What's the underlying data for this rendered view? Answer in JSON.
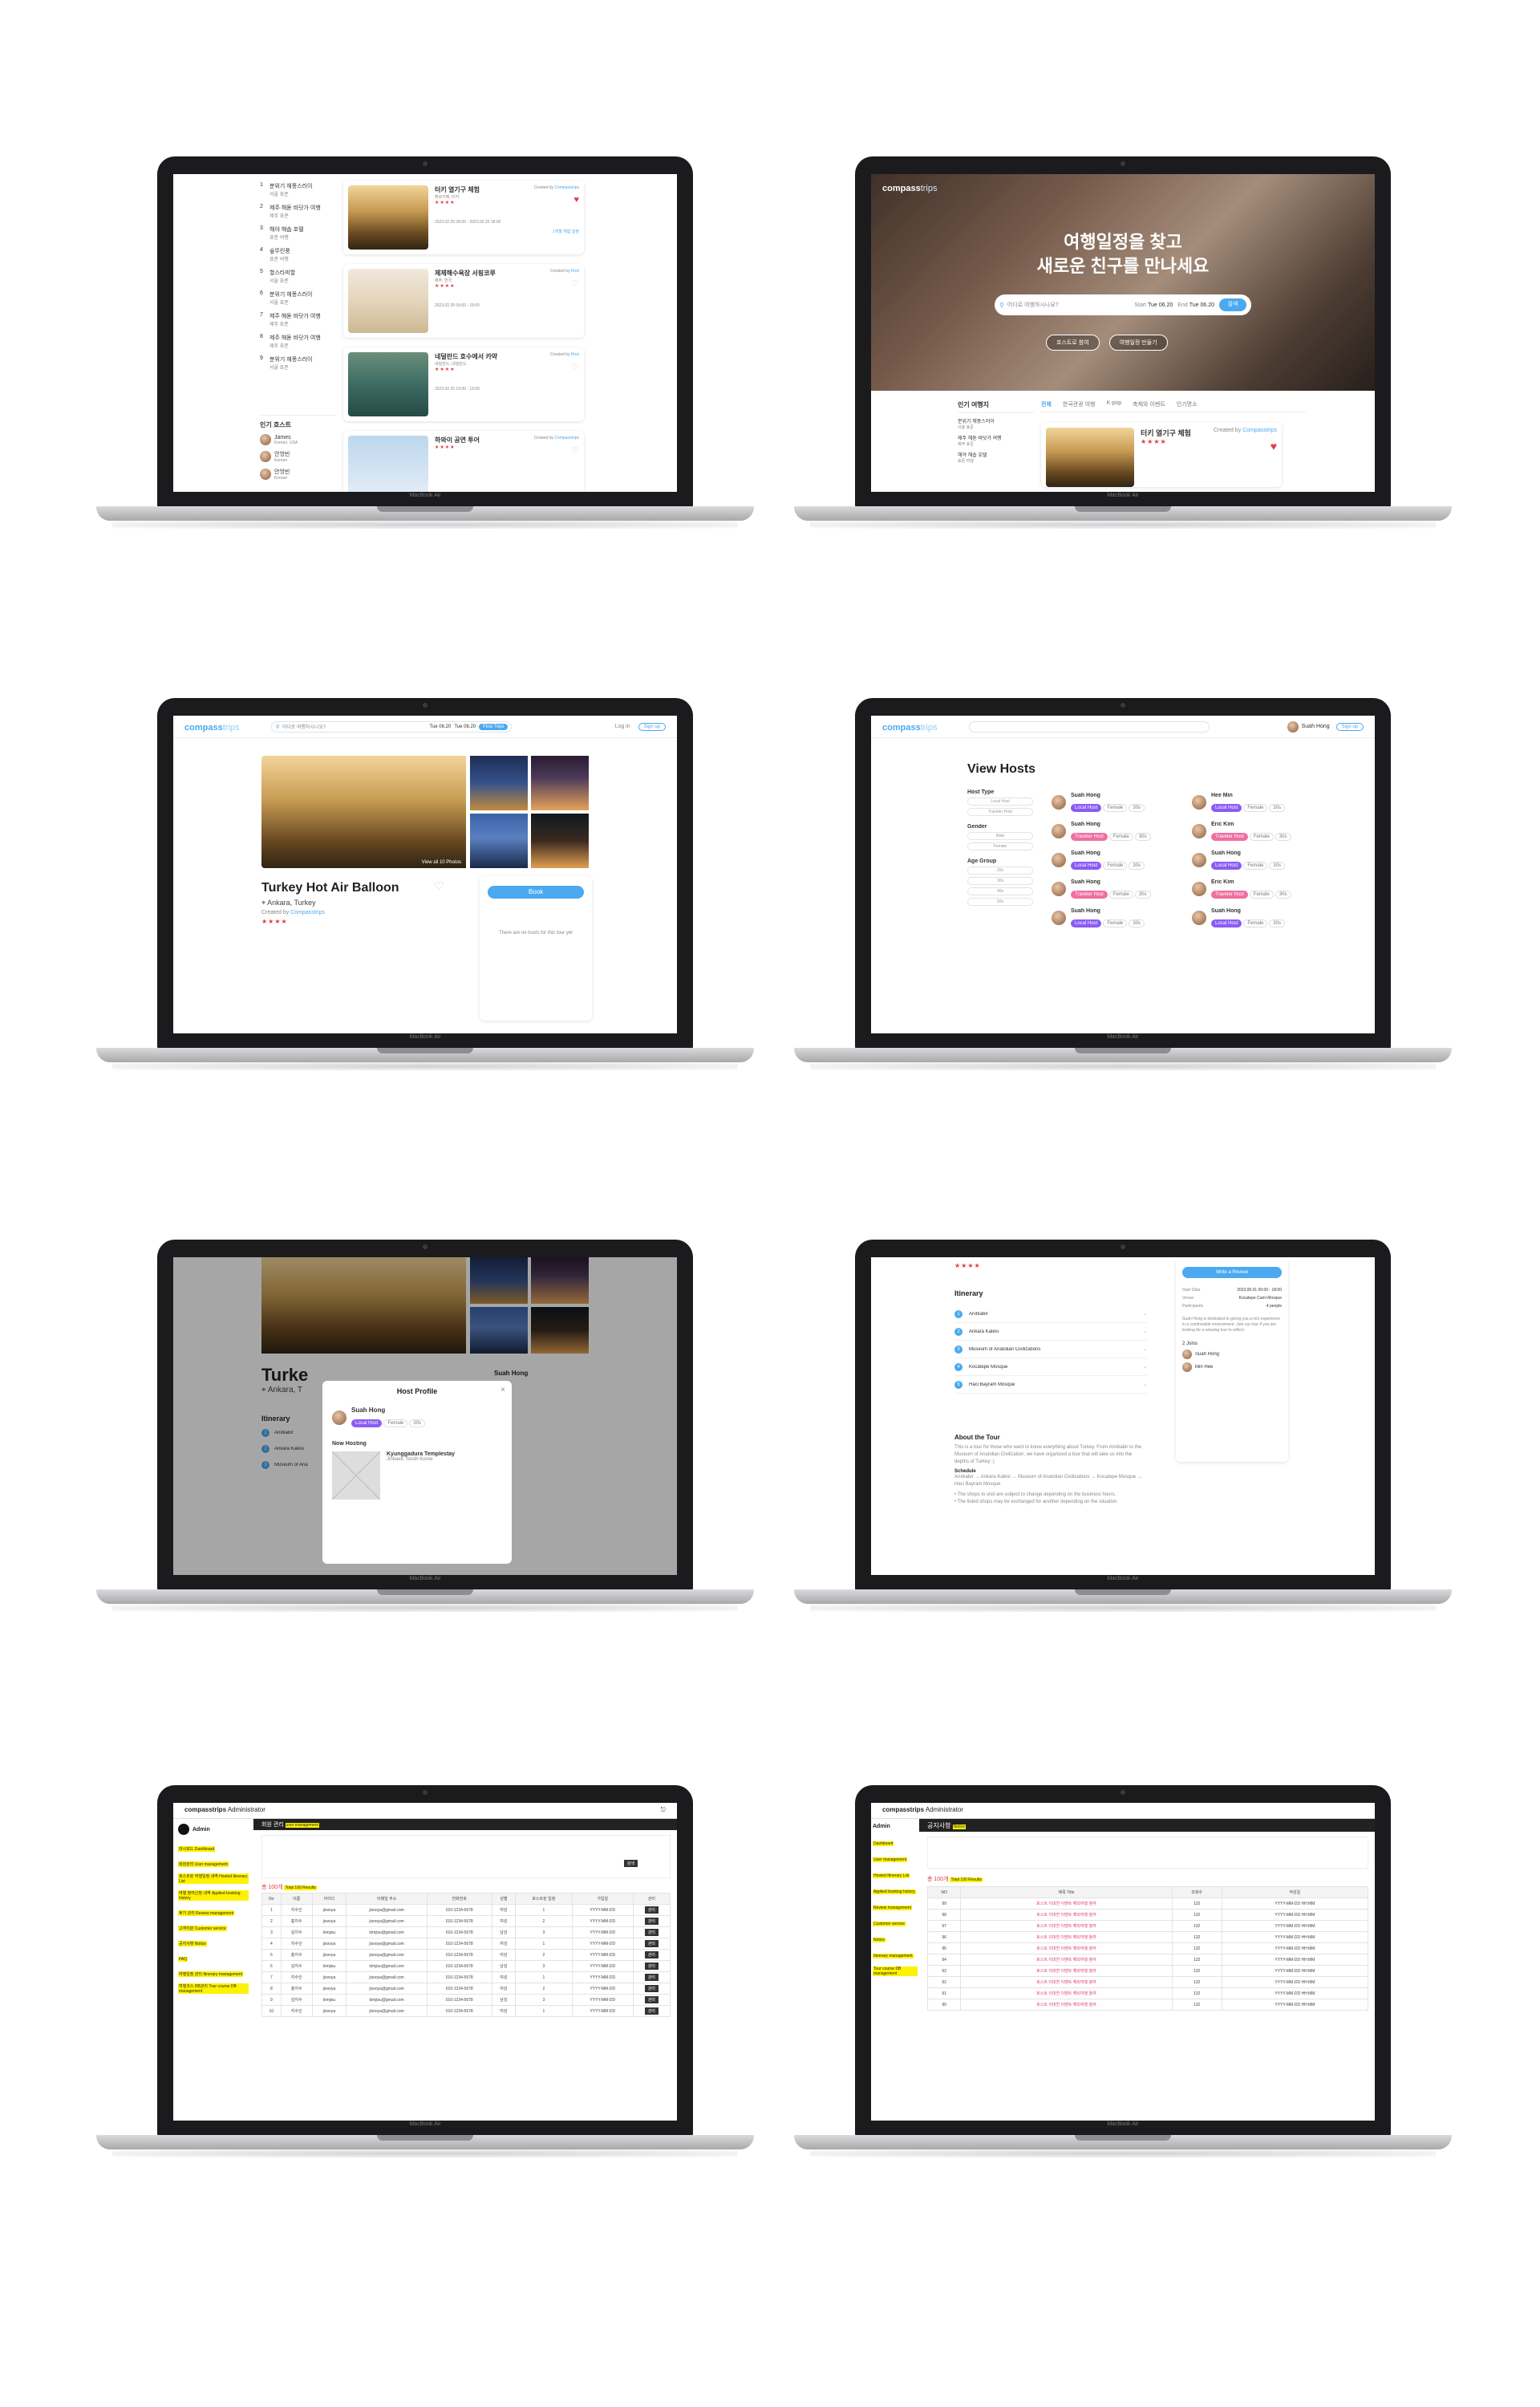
{
  "laptop_model": "MacBook Air",
  "screen1": {
    "ranking": [
      {
        "n": "1",
        "title": "분위기 헤풍스러이",
        "sub": "서울 표준"
      },
      {
        "n": "2",
        "title": "제주 해돋 바닷가 여행",
        "sub": "제주 표준"
      },
      {
        "n": "3",
        "title": "해야 해솝 호텔",
        "sub": "표준 여행"
      },
      {
        "n": "4",
        "title": "숲뚜린풍",
        "sub": "표준 여행"
      },
      {
        "n": "5",
        "title": "할스타피할",
        "sub": "서울 표준"
      },
      {
        "n": "6",
        "title": "분위기 헤풍스러이",
        "sub": "서울 표준"
      },
      {
        "n": "7",
        "title": "제주 해돋 바닷가 여행",
        "sub": "제주 표준"
      },
      {
        "n": "8",
        "title": "제주 해돋 바닷가 여행",
        "sub": "제주 표준"
      },
      {
        "n": "9",
        "title": "분위기 헤풍스러이",
        "sub": "서울 표준"
      }
    ],
    "popular_hosts_label": "인기 호스트",
    "hosts": [
      {
        "name": "James",
        "sub": "Korean, USA"
      },
      {
        "name": "안엉빈",
        "sub": "Korean"
      },
      {
        "name": "안엉빈",
        "sub": "Korean"
      }
    ],
    "cards": [
      {
        "title": "터키 열기구 체험",
        "loc": "튀르키예, 터키",
        "by": "Created by",
        "creator": "Compasstrips",
        "date": "2023.02.25 09:00 - 2023.03.25 18:00",
        "link": "1개월 체험 일정",
        "liked": true
      },
      {
        "title": "제제해수욕장 서핑코루",
        "loc": "제주, 한국",
        "by": "Created by",
        "creator": "Host",
        "date": "2023.02.25 09:00 - 18:00",
        "link": "",
        "liked": false
      },
      {
        "title": "네덜란드 호수에서 카약",
        "loc": "네덜란드, 네덜란드",
        "by": "Created by",
        "creator": "Host",
        "date": "2023.02.25 10:00 - 13:00",
        "link": "",
        "liked": false
      },
      {
        "title": "하와이 공연 투어",
        "loc": "",
        "by": "Created by",
        "creator": "Compasstrips",
        "date": "",
        "link": "",
        "liked": false
      }
    ]
  },
  "screen2": {
    "logo_main": "compass",
    "logo_sub": "trips",
    "hero_line1": "여행일정을 찾고",
    "hero_line2": "새로운 친구를 만나세요",
    "search_placeholder": "어디로 여행하시나요?",
    "start_label": "Start",
    "start_value": "Tue 06.20",
    "end_label": "End",
    "end_value": "Tue 06.20",
    "search_btn": "검색",
    "cta_left": "호스트로 참여",
    "cta_right": "여행일정 만들기",
    "sidebar_title": "인기 여행지",
    "tabs": [
      "전체",
      "한국관광 여행",
      "K-pop",
      "축제와 이벤트",
      "인기명소"
    ],
    "rank": [
      {
        "title": "분위기 헤풍스러이",
        "sub": "서울 표준"
      },
      {
        "title": "제주 해돋 바닷가 여행",
        "sub": "제주 표준"
      },
      {
        "title": "해야 해솝 호텔",
        "sub": "표준 여행"
      }
    ],
    "card": {
      "title": "터키 열기구 체험",
      "by": "Created by",
      "creator": "Compasstrips"
    }
  },
  "screen3": {
    "logo_main": "compass",
    "logo_sub": "trips",
    "search_placeholder": "어디로 여행하시나요?",
    "start_value": "Tue 06.20",
    "end_value": "Tue 06.20",
    "search_btn": "Find Trips",
    "login": "Log in",
    "signup": "Sign up",
    "title": "Turkey Hot Air Balloon",
    "location": "Ankara, Turkey",
    "created_by": "Created by",
    "creator": "Compasstrips",
    "view_all": "View all 10 Photos",
    "book_btn": "Book",
    "note": "There are no hosts for this tour yet"
  },
  "screen4": {
    "logo_main": "compass",
    "logo_sub": "trips",
    "user": "Suah Hong",
    "signup": "Sign up",
    "heading": "View Hosts",
    "filters": [
      {
        "label": "Host Type",
        "opts": [
          "Local Host",
          "Traveler Host"
        ]
      },
      {
        "label": "Gender",
        "opts": [
          "Male",
          "Female"
        ]
      },
      {
        "label": "Age Group",
        "opts": [
          "20s",
          "30s",
          "40s",
          "50s"
        ]
      }
    ],
    "hosts_left": [
      "Suah Hong",
      "Suah Hong",
      "Suah Hong",
      "Suah Hong",
      "Suah Hong"
    ],
    "hosts_right": [
      "Hee Min",
      "Eric Kim",
      "Suah Hong",
      "Eric Kim",
      "Suah Hong"
    ]
  },
  "screen5": {
    "title_partial": "Turke",
    "location_partial": "Ankara, T",
    "itinerary": "Itinerary",
    "modal_title": "Host Profile",
    "host_name": "Suah Hong",
    "now_hosting": "Now Hosting",
    "tour_name": "Kyunggadura Templestay",
    "tour_sub": "Jinbaek, South Korea",
    "side_host": "Suah Hong",
    "view_all": "View all 10 Photos",
    "stops": [
      "Anıtkabir",
      "Ankara Kalesi",
      "Museum of Ana"
    ]
  },
  "screen6": {
    "itinerary": "Itinerary",
    "stops": [
      "Anıtkabir",
      "Ankara Kalesi",
      "Museum of Anatolian Civilizations",
      "Kocatepe Mosque",
      "Haci Bayram Mosque"
    ],
    "about_title": "About the Tour",
    "about_text": "This is a tour for those who want to know everything about Turkey. From Anıtkabir to the Museum of Anatolian Civilization, we have organized a tour that will take us into the depths of Turkey :)",
    "schedule_label": "Schedule",
    "schedule_text": "Anıtkabir → Ankara Kalesi → Museum of Anatolian Civilizations → Kocatepe Mosque → Haci Bayram Mosque",
    "bullet1": "The shops to visit are subject to change depending on the business hours.",
    "bullet2": "The listed shops may be exchanged for another depending on the situation.",
    "review_btn": "Write a Review",
    "start_label": "Start Date",
    "start_value": "2023.06.01 09:00 - 18:00",
    "venue_label": "Venue",
    "venue_value": "Kocatepe Cami Mosque",
    "people_label": "Participants",
    "people_value": "4 people",
    "host_desc": "Suah Hong is dedicated to giving you a rich experience in a comfortable environment. Join our tour if you are looking for a relaxing tour to reflect.",
    "joined": "2 Joins",
    "host_a": "Suah Hong",
    "host_b": "Min Hee"
  },
  "screen7": {
    "brand": "compasstrips",
    "admin": "Administrator",
    "user": "Admin",
    "section": "회원 관리",
    "section_en": "user management",
    "nav": [
      "대시보드 Dashboard",
      "회원관리 User management",
      "호스트된 여행일정 내역 Hosted Itinerary List",
      "여행 참여신청 내역 Applied booking history",
      "후기 관리 Review management",
      "고객지원 Customer service",
      "공지사항 Notice",
      "FAQ",
      "여행일정 관리 Itinerary management",
      "여행코스 DB관리 Tour course DB management"
    ],
    "total": "총 100개",
    "total_en": "Total 100 Results",
    "headers": [
      "No",
      "이름",
      "아이디",
      "이메일 주소",
      "전화번호",
      "성별",
      "호스트된 일정",
      "가입일",
      "관리"
    ],
    "rows": [
      [
        "1",
        "지수인",
        "jisooya",
        "jisooya@gmail.com",
        "010-1234-5678",
        "여성",
        "1",
        "YYYY-MM-DD"
      ],
      [
        "2",
        "홍지수",
        "jisooya",
        "jisooya@gmail.com",
        "010-1234-5678",
        "여성",
        "2",
        "YYYY-MM-DD"
      ],
      [
        "3",
        "김지수",
        "kimjisu",
        "kimjisu@gmail.com",
        "010-1234-5678",
        "남성",
        "3",
        "YYYY-MM-DD"
      ],
      [
        "4",
        "지수인",
        "jisooya",
        "jisooya@gmail.com",
        "010-1234-5678",
        "여성",
        "1",
        "YYYY-MM-DD"
      ],
      [
        "5",
        "홍지수",
        "jisooya",
        "jisooya@gmail.com",
        "010-1234-5678",
        "여성",
        "2",
        "YYYY-MM-DD"
      ],
      [
        "6",
        "김지수",
        "kimjisu",
        "kimjisu@gmail.com",
        "010-1234-5678",
        "남성",
        "3",
        "YYYY-MM-DD"
      ],
      [
        "7",
        "지수인",
        "jisooya",
        "jisooya@gmail.com",
        "010-1234-5678",
        "여성",
        "1",
        "YYYY-MM-DD"
      ],
      [
        "8",
        "홍지수",
        "jisooya",
        "jisooya@gmail.com",
        "010-1234-5678",
        "여성",
        "2",
        "YYYY-MM-DD"
      ],
      [
        "9",
        "김지수",
        "kimjisu",
        "kimjisu@gmail.com",
        "010-1234-5678",
        "남성",
        "3",
        "YYYY-MM-DD"
      ],
      [
        "10",
        "지수인",
        "jisooya",
        "jisooya@gmail.com",
        "010-1234-5678",
        "여성",
        "1",
        "YYYY-MM-DD"
      ]
    ],
    "search_btn": "검색",
    "manage_btn": "관리"
  },
  "screen8": {
    "brand": "compasstrips",
    "admin": "Administrator",
    "user": "Admin",
    "section": "공지사항",
    "section_en": "Notice",
    "nav": [
      "Dashboard",
      "User management",
      "Hosted Itinerary List",
      "Applied booking history",
      "Review management",
      "Customer service",
      "Notice",
      "Itinerary management",
      "Tour course DB management"
    ],
    "total": "총 100개",
    "total_en": "Total 100 Results",
    "headers": [
      "NO",
      "제목 Title",
      "조회수",
      "작성일"
    ],
    "rows": [
      [
        "99",
        "호스트 이대연 이벤트 해외여행 참여",
        "132",
        "YYYY-MM-DD HH:MM"
      ],
      [
        "98",
        "호스트 이대연 이벤트 해외여행 참여",
        "132",
        "YYYY-MM-DD HH:MM"
      ],
      [
        "97",
        "호스트 이대연 이벤트 해외여행 참여",
        "132",
        "YYYY-MM-DD HH:MM"
      ],
      [
        "96",
        "호스트 이대연 이벤트 해외여행 참여",
        "132",
        "YYYY-MM-DD HH:MM"
      ],
      [
        "95",
        "호스트 이대연 이벤트 해외여행 참여",
        "132",
        "YYYY-MM-DD HH:MM"
      ],
      [
        "94",
        "호스트 이대연 이벤트 해외여행 참여",
        "132",
        "YYYY-MM-DD HH:MM"
      ],
      [
        "93",
        "호스트 이대연 이벤트 해외여행 참여",
        "132",
        "YYYY-MM-DD HH:MM"
      ],
      [
        "92",
        "호스트 이대연 이벤트 해외여행 참여",
        "132",
        "YYYY-MM-DD HH:MM"
      ],
      [
        "91",
        "호스트 이대연 이벤트 해외여행 참여",
        "132",
        "YYYY-MM-DD HH:MM"
      ],
      [
        "90",
        "호스트 이대연 이벤트 해외여행 참여",
        "132",
        "YYYY-MM-DD HH:MM"
      ]
    ]
  }
}
